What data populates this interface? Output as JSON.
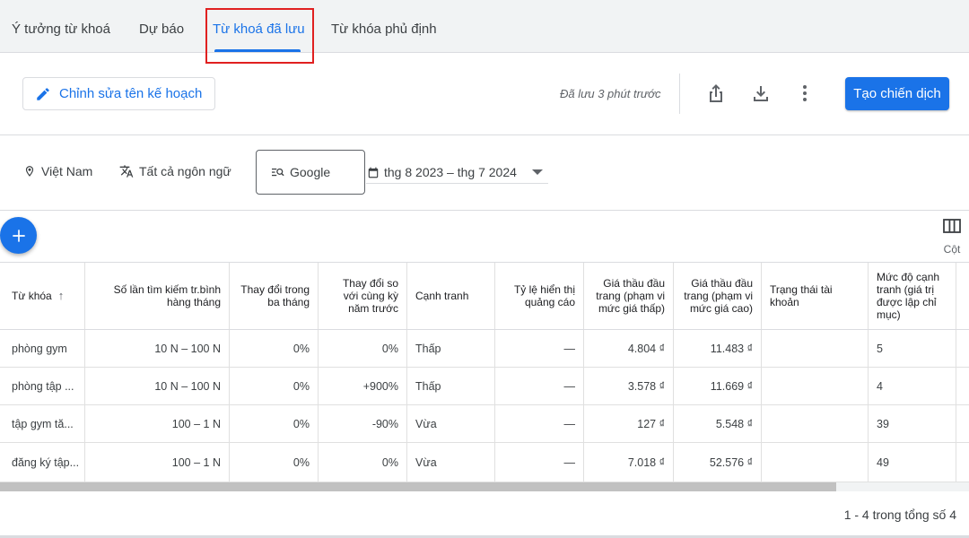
{
  "tabs": [
    {
      "label": "Ý tưởng từ khoá",
      "active": false
    },
    {
      "label": "Dự báo",
      "active": false
    },
    {
      "label": "Từ khoá đã lưu",
      "active": true
    },
    {
      "label": "Từ khóa phủ định",
      "active": false
    }
  ],
  "toolbar": {
    "edit_label": "Chỉnh sửa tên kế hoạch",
    "saved_status": "Đã lưu 3 phút trước",
    "create_label": "Tạo chiến dịch",
    "icons": [
      "share-icon",
      "download-icon",
      "more-vert-icon"
    ]
  },
  "filters": {
    "location": "Việt Nam",
    "language": "Tất cả ngôn ngữ",
    "network": "Google",
    "date_range": "thg 8 2023 – thg 7 2024"
  },
  "columns_label": "Cột",
  "table": {
    "headers": [
      "Từ khóa",
      "Số lần tìm kiếm tr.bình hàng tháng",
      "Thay đổi trong ba tháng",
      "Thay đổi so với cùng kỳ năm trước",
      "Cạnh tranh",
      "Tỷ lệ hiển thị quảng cáo",
      "Giá thầu đầu trang (phạm vi mức giá thấp)",
      "Giá thầu đầu trang (phạm vi mức giá cao)",
      "Trạng thái tài khoản",
      "Mức độ cạnh tranh (giá trị được lập chỉ mục)"
    ],
    "rows": [
      [
        "phòng gym",
        "10 N – 100 N",
        "0%",
        "0%",
        "Thấp",
        "—",
        "4.804 ₫",
        "11.483 ₫",
        "",
        "5"
      ],
      [
        "phòng tập ...",
        "10 N – 100 N",
        "0%",
        "+900%",
        "Thấp",
        "—",
        "3.578 ₫",
        "11.669 ₫",
        "",
        "4"
      ],
      [
        "tập gym tă...",
        "100 – 1 N",
        "0%",
        "-90%",
        "Vừa",
        "—",
        "127 ₫",
        "5.548 ₫",
        "",
        "39"
      ],
      [
        "đăng ký tập...",
        "100 – 1 N",
        "0%",
        "0%",
        "Vừa",
        "—",
        "7.018 ₫",
        "52.576 ₫",
        "",
        "49"
      ]
    ]
  },
  "pagination": "1 - 4 trong tổng số 4",
  "colors": {
    "accent": "#1a73e8",
    "highlight": "#e02020"
  }
}
